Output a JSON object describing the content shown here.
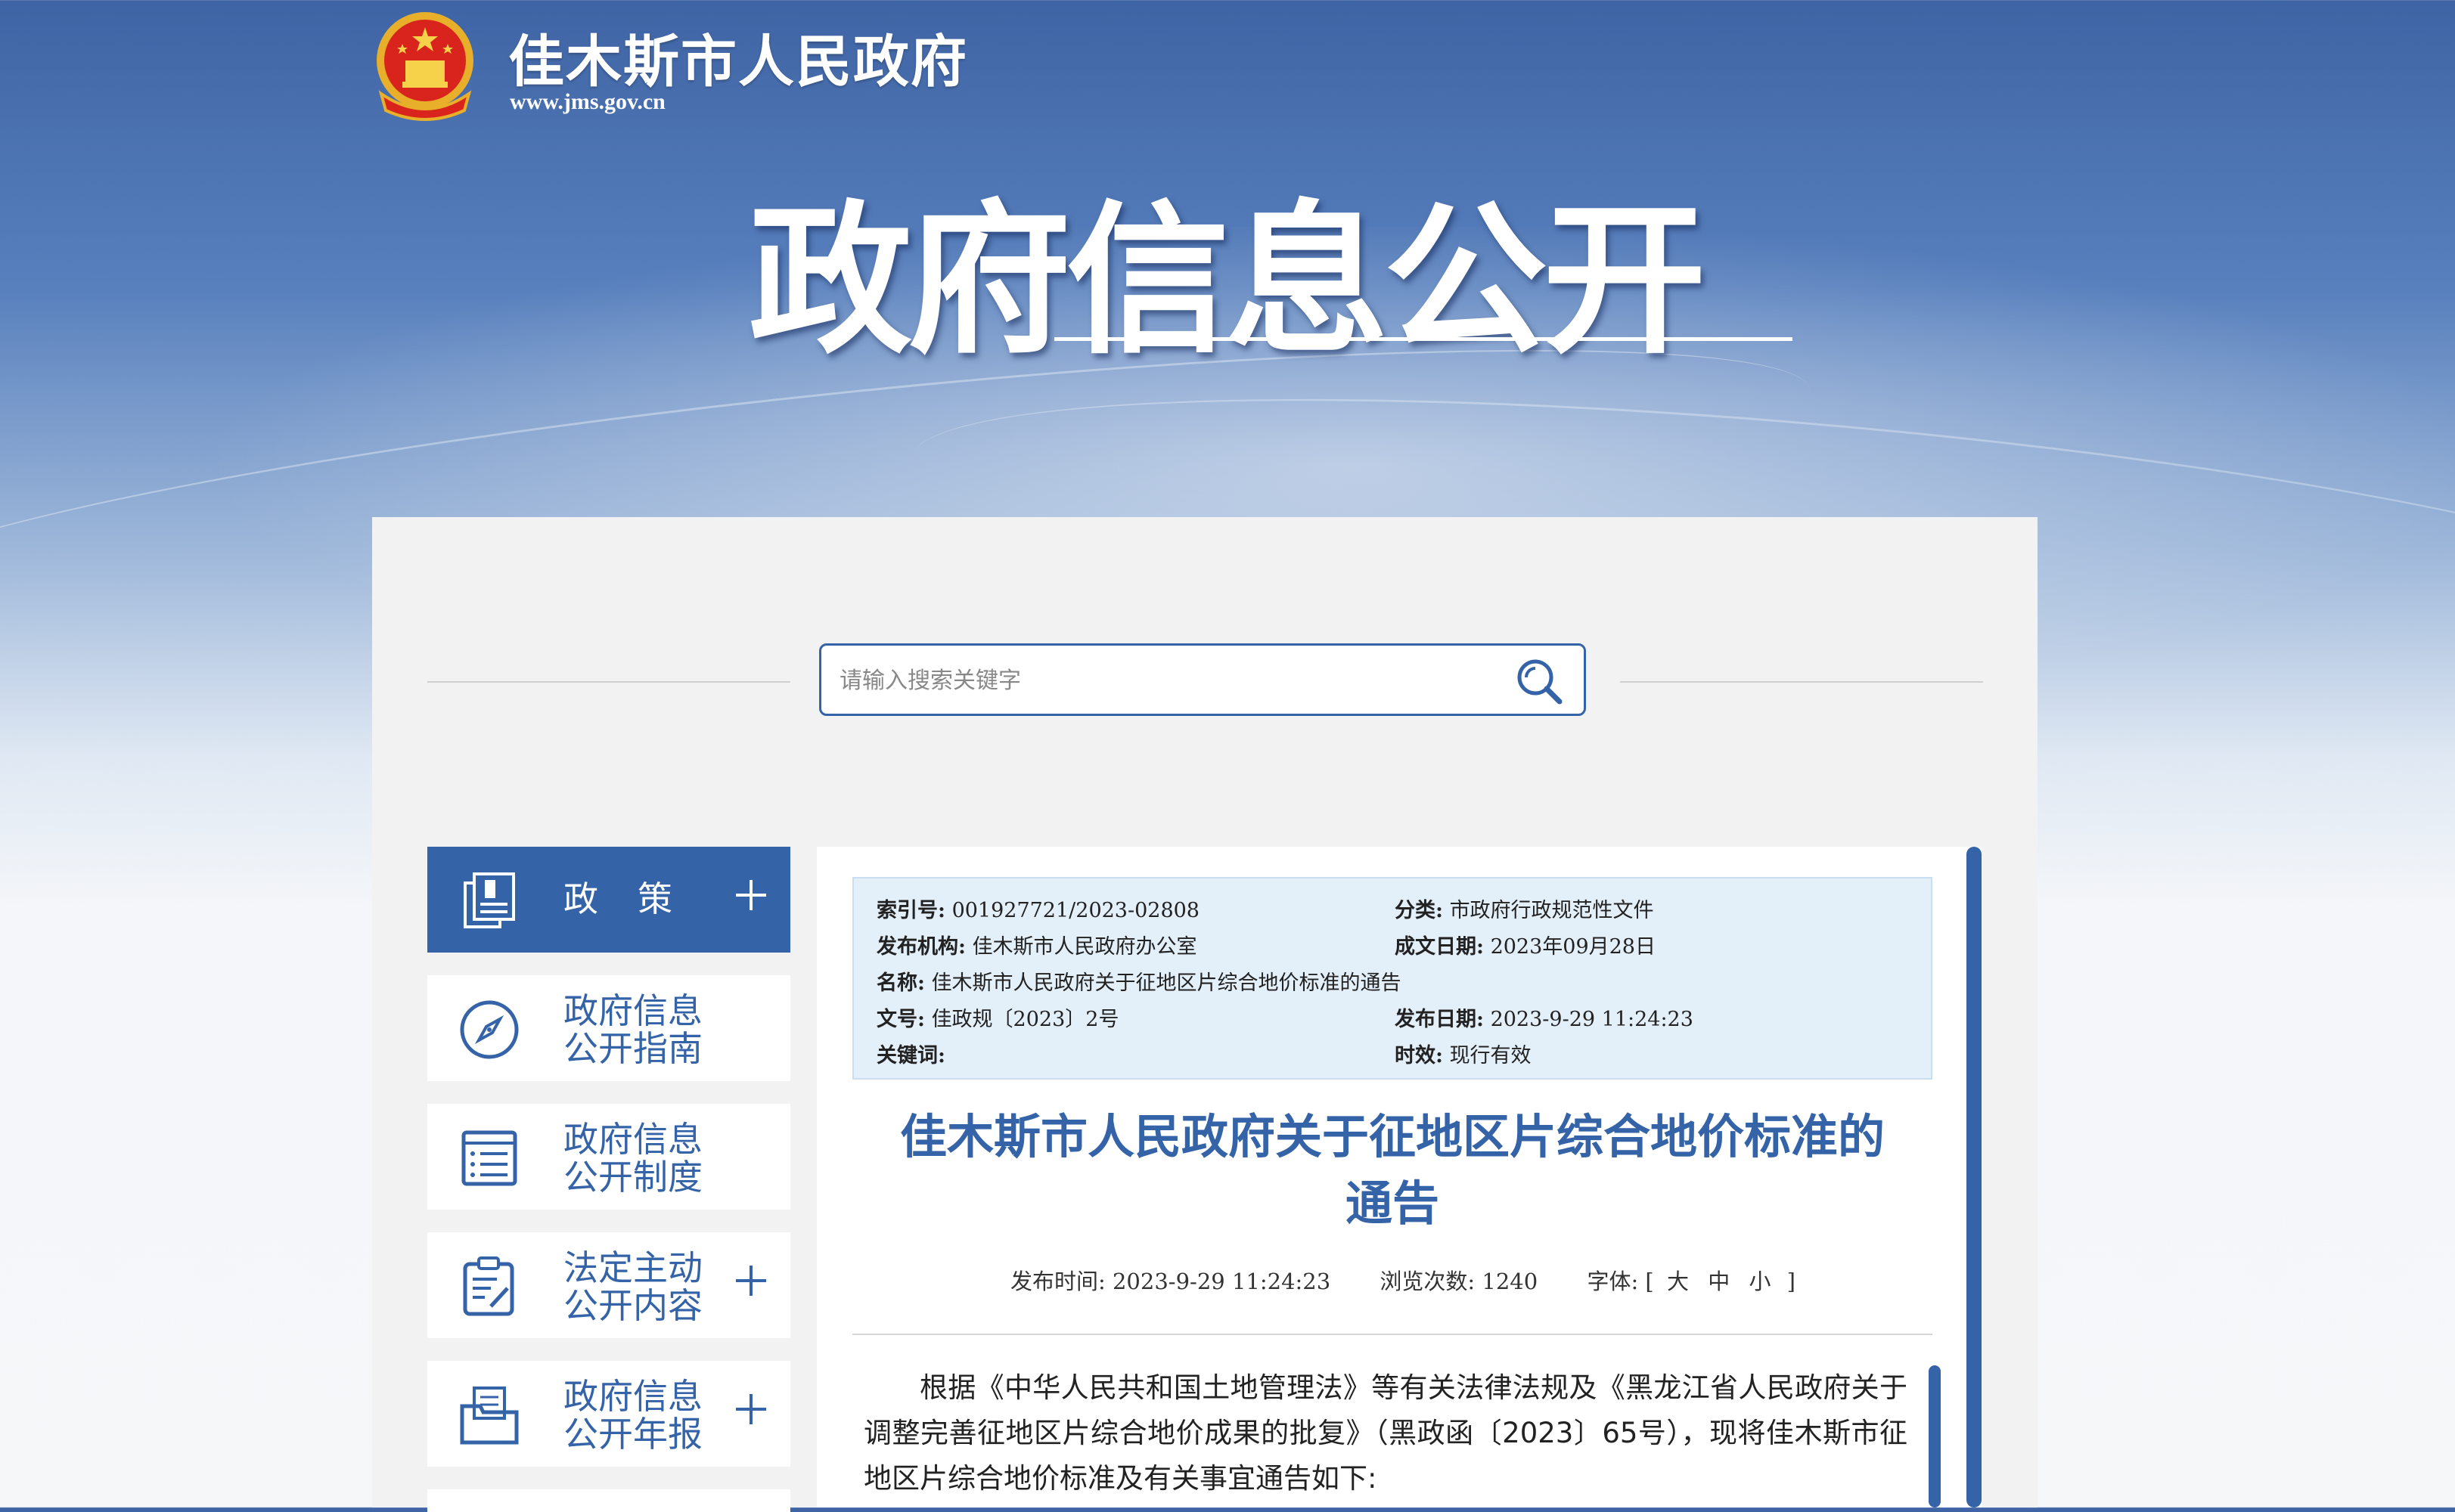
{
  "header": {
    "site_name": "佳木斯市人民政府",
    "site_url": "www.jms.gov.cn",
    "banner_title": "政府信息公开",
    "emblem_icon": "national-emblem-icon"
  },
  "search": {
    "placeholder": "请输入搜索关键字",
    "icon": "search-icon"
  },
  "sidebar": {
    "items": [
      {
        "label": "政策",
        "icon": "policy-doc-icon",
        "expandable": true,
        "active": true
      },
      {
        "label": "政府信息\n公开指南",
        "icon": "compass-icon",
        "expandable": false
      },
      {
        "label": "政府信息\n公开制度",
        "icon": "list-icon",
        "expandable": false
      },
      {
        "label": "法定主动\n公开内容",
        "icon": "clipboard-edit-icon",
        "expandable": true
      },
      {
        "label": "政府信息\n公开年报",
        "icon": "folder-icon",
        "expandable": true
      }
    ]
  },
  "meta": {
    "index_label": "索引号:",
    "index_value": "001927721/2023-02808",
    "category_label": "分类:",
    "category_value": "市政府行政规范性文件",
    "publisher_label": "发布机构:",
    "publisher_value": "佳木斯市人民政府办公室",
    "written_label": "成文日期:",
    "written_value": "2023年09月28日",
    "name_label": "名称:",
    "name_value": "佳木斯市人民政府关于征地区片综合地价标准的通告",
    "docno_label": "文号:",
    "docno_value": "佳政规〔2023〕2号",
    "pubdate_label": "发布日期:",
    "pubdate_value": "2023-9-29 11:24:23",
    "keyword_label": "关键词:",
    "keyword_value": "",
    "validity_label": "时效:",
    "validity_value": "现行有效"
  },
  "article": {
    "title_line1": "佳木斯市人民政府关于征地区片综合地价标准的",
    "title_line2": "通告",
    "publish_time": "发布时间: 2023-9-29 11:24:23",
    "views": "浏览次数: 1240",
    "font_size_label": "字体: [",
    "font_large": "大",
    "font_medium": "中",
    "font_small": "小",
    "font_close": "]",
    "body": "根据《中华人民共和国土地管理法》等有关法律法规及《黑龙江省人民政府关于调整完善征地区片综合地价成果的批复》（黑政函〔2023〕65号），现将佳木斯市征地区片综合地价标准及有关事宜通告如下:"
  },
  "colors": {
    "accent": "#3563a7",
    "meta_bg": "#e3eff9"
  }
}
